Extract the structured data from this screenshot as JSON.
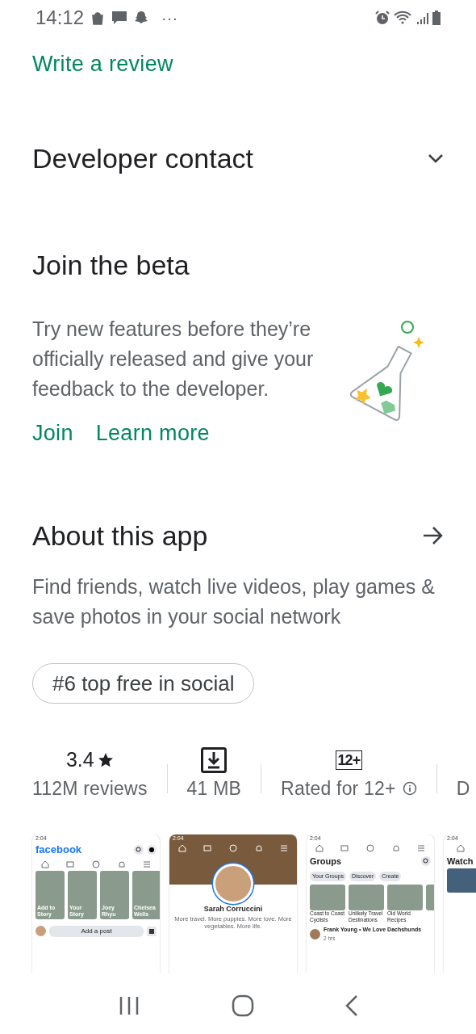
{
  "status_bar": {
    "time": "14:12",
    "more": "···"
  },
  "write_review": "Write a review",
  "developer_contact": {
    "title": "Developer contact",
    "expanded": false
  },
  "beta": {
    "title": "Join the beta",
    "text": "Try new features before they’re officially released and give your feedback to the developer.",
    "links": [
      "Join",
      "Learn more"
    ]
  },
  "about": {
    "title": "About this app",
    "text": "Find friends, watch live videos, play games & save photos in your social network",
    "chip": "#6 top free in social"
  },
  "stats": [
    {
      "kind": "rating",
      "value": "3.4",
      "label": "112M reviews"
    },
    {
      "kind": "size",
      "label": "41 MB"
    },
    {
      "kind": "age",
      "badge": "12+",
      "label": "Rated for 12+"
    },
    {
      "kind": "cut",
      "label": "D"
    }
  ],
  "screenshots": [
    {
      "kind": "feed",
      "time": "2:04",
      "logo": "facebook",
      "stories": [
        "Add to Story",
        "Your Story",
        "Joey Rhyu",
        "Chelsea Wells"
      ],
      "post_prompt": "Add a post"
    },
    {
      "kind": "profile",
      "time": "2:04",
      "name": "Sarah Corruccini",
      "bio": "More travel. More puppies. More love. More vegetables. More life."
    },
    {
      "kind": "groups",
      "time": "2:04",
      "title": "Groups",
      "chips": [
        "Your Groups",
        "Discover",
        "Create"
      ],
      "tiles": [
        "Coast to Coast Cyclists",
        "Unlikely Travel Destinations",
        "Old World Recipes"
      ],
      "post": "Frank Young • We Love Dachshunds",
      "post_time": "2 hrs"
    },
    {
      "kind": "watch",
      "time": "2:04",
      "title": "Watch"
    }
  ]
}
